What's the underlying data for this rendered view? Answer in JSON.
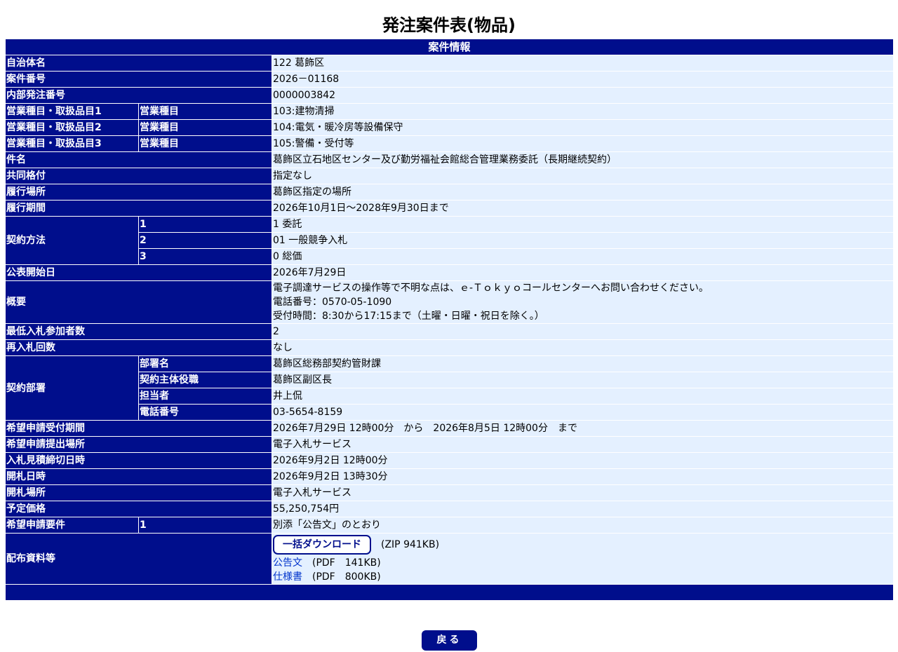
{
  "page_title": "発注案件表(物品)",
  "section_header": "案件情報",
  "fields": {
    "municipality": {
      "label": "自治体名",
      "value": "122 葛飾区"
    },
    "case_number": {
      "label": "案件番号",
      "value": "2026－01168"
    },
    "internal_order_number": {
      "label": "内部発注番号",
      "value": "0000003842"
    },
    "business_categories": [
      {
        "label": "営業種目・取扱品目1",
        "sublabel": "営業種目",
        "value": "103:建物清掃"
      },
      {
        "label": "営業種目・取扱品目2",
        "sublabel": "営業種目",
        "value": "104:電気・暖冷房等設備保守"
      },
      {
        "label": "営業種目・取扱品目3",
        "sublabel": "営業種目",
        "value": "105:警備・受付等"
      }
    ],
    "subject": {
      "label": "件名",
      "value": "葛飾区立石地区センター及び勤労福祉会館総合管理業務委託（長期継続契約）"
    },
    "joint_rating": {
      "label": "共同格付",
      "value": "指定なし"
    },
    "performance_location": {
      "label": "履行場所",
      "value": "葛飾区指定の場所"
    },
    "performance_period": {
      "label": "履行期間",
      "value": "2026年10月1日～2028年9月30日まで"
    },
    "contract_method": {
      "label": "契約方法",
      "items": [
        {
          "num": "1",
          "value": "1 委託"
        },
        {
          "num": "2",
          "value": "01 一般競争入札"
        },
        {
          "num": "3",
          "value": "0 総価"
        }
      ]
    },
    "publication_date": {
      "label": "公表開始日",
      "value": "2026年7月29日"
    },
    "summary": {
      "label": "概要",
      "lines": [
        "電子調達サービスの操作等で不明な点は、ｅ-Ｔｏｋｙｏコールセンターへお問い合わせください。",
        "電話番号：0570-05-1090",
        "受付時間：8:30から17:15まで（土曜・日曜・祝日を除く。）"
      ]
    },
    "min_bidders": {
      "label": "最低入札参加者数",
      "value": "2"
    },
    "rebid_count": {
      "label": "再入札回数",
      "value": "なし"
    },
    "contract_department": {
      "label": "契約部署",
      "items": [
        {
          "sublabel": "部署名",
          "value": "葛飾区総務部契約管財課"
        },
        {
          "sublabel": "契約主体役職",
          "value": "葛飾区副区長"
        },
        {
          "sublabel": "担当者",
          "value": "井上侃"
        },
        {
          "sublabel": "電話番号",
          "value": "03-5654-8159"
        }
      ]
    },
    "application_period": {
      "label": "希望申請受付期間",
      "value": "2026年7月29日 12時00分　から　2026年8月5日 12時00分　まで"
    },
    "application_place": {
      "label": "希望申請提出場所",
      "value": "電子入札サービス"
    },
    "bid_deadline": {
      "label": "入札見積締切日時",
      "value": "2026年9月2日 12時00分"
    },
    "opening_datetime": {
      "label": "開札日時",
      "value": "2026年9月2日 13時30分"
    },
    "opening_place": {
      "label": "開札場所",
      "value": "電子入札サービス"
    },
    "estimated_price": {
      "label": "予定価格",
      "value": "55,250,754円"
    },
    "application_requirements": {
      "label": "希望申請要件",
      "num": "1",
      "value": "別添「公告文」のとおり"
    },
    "distribution_materials": {
      "label": "配布資料等",
      "download_all_label": "一括ダウンロード",
      "download_all_size": "(ZIP 941KB)",
      "documents": [
        {
          "name": "公告文",
          "size": "(PDF　141KB)"
        },
        {
          "name": "仕様書",
          "size": "(PDF　800KB)"
        }
      ]
    }
  },
  "back_button_label": "戻る",
  "colors": {
    "header_bg": "#000e8c",
    "value_bg": "#e4f0ff",
    "link": "#0033cc"
  }
}
